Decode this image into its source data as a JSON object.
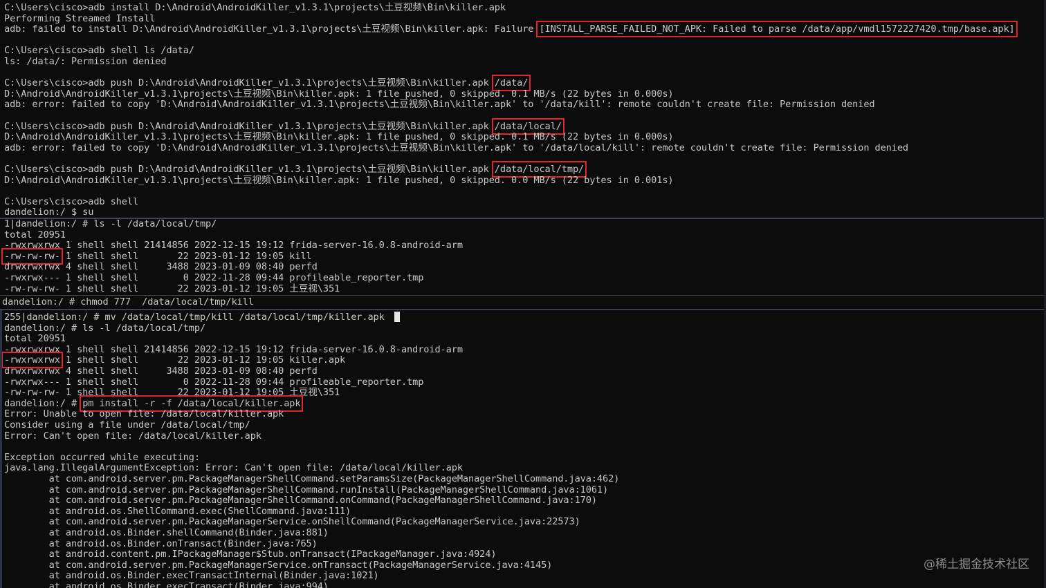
{
  "top": [
    "C:\\Users\\cisco>adb install D:\\Android\\AndroidKiller_v1.3.1\\projects\\土豆视频\\Bin\\killer.apk",
    "Performing Streamed Install",
    {
      "pre": "adb: failed to install D:\\Android\\AndroidKiller_v1.3.1\\projects\\土豆视频\\Bin\\killer.apk: Failure ",
      "hl": "[INSTALL_PARSE_FAILED_NOT_APK: Failed to parse /data/app/vmdl1572227420.tmp/base.apk]"
    },
    "",
    "C:\\Users\\cisco>adb shell ls /data/",
    "ls: /data/: Permission denied",
    "",
    {
      "pre": "C:\\Users\\cisco>adb push D:\\Android\\AndroidKiller_v1.3.1\\projects\\土豆视频\\Bin\\killer.apk ",
      "hl": "/data/"
    },
    "D:\\Android\\AndroidKiller_v1.3.1\\projects\\土豆视频\\Bin\\killer.apk: 1 file pushed, 0 skipped. 0.1 MB/s (22 bytes in 0.000s)",
    "adb: error: failed to copy 'D:\\Android\\AndroidKiller_v1.3.1\\projects\\土豆视频\\Bin\\killer.apk' to '/data/kill': remote couldn't create file: Permission denied",
    "",
    {
      "pre": "C:\\Users\\cisco>adb push D:\\Android\\AndroidKiller_v1.3.1\\projects\\土豆视频\\Bin\\killer.apk ",
      "hl": "/data/local/"
    },
    "D:\\Android\\AndroidKiller_v1.3.1\\projects\\土豆视频\\Bin\\killer.apk: 1 file pushed, 0 skipped. 0.1 MB/s (22 bytes in 0.000s)",
    "adb: error: failed to copy 'D:\\Android\\AndroidKiller_v1.3.1\\projects\\土豆视频\\Bin\\killer.apk' to '/data/local/kill': remote couldn't create file: Permission denied",
    "",
    {
      "pre": "C:\\Users\\cisco>adb push D:\\Android\\AndroidKiller_v1.3.1\\projects\\土豆视频\\Bin\\killer.apk ",
      "hl": "/data/local/tmp/"
    },
    "D:\\Android\\AndroidKiller_v1.3.1\\projects\\土豆视频\\Bin\\killer.apk: 1 file pushed, 0 skipped. 0.0 MB/s (22 bytes in 0.001s)",
    "",
    "C:\\Users\\cisco>adb shell",
    "dandelion:/ $ su"
  ],
  "mid": [
    "1|dandelion:/ # ls -l /data/local/tmp/",
    "total 20951",
    "-rwxrwxrwx 1 shell shell 21414856 2022-12-15 19:12 frida-server-16.0.8-android-arm",
    {
      "hl": "-rw-rw-rw-",
      "post": " 1 shell shell       22 2023-01-12 19:05 kill"
    },
    "drwxrwxrwx 4 shell shell     3488 2023-01-09 08:40 perfd",
    "-rwxrwx--- 1 shell shell        0 2022-11-28 09:44 profileable_reporter.tmp",
    "-rw-rw-rw- 1 shell shell       22 2023-01-12 19:05 土豆视\\351"
  ],
  "cmd": "dandelion:/ # chmod 777  /data/local/tmp/kill",
  "bottom": [
    {
      "pre": "255|dandelion:/ # mv /data/local/tmp/kill /data/local/tmp/killer.apk",
      "cursor": true
    },
    "dandelion:/ # ls -l /data/local/tmp/",
    "total 20951",
    "-rwxrwxrwx 1 shell shell 21414856 2022-12-15 19:12 frida-server-16.0.8-android-arm",
    {
      "hl": "-rwxrwxrwx",
      "post": " 1 shell shell       22 2023-01-12 19:05 killer.apk"
    },
    "drwxrwxrwx 4 shell shell     3488 2023-01-09 08:40 perfd",
    "-rwxrwx--- 1 shell shell        0 2022-11-28 09:44 profileable_reporter.tmp",
    "-rw-rw-rw- 1 shell shell       22 2023-01-12 19:05 土豆视\\351",
    {
      "pre": "dandelion:/ # ",
      "hl": "pm install -r -f /data/local/killer.apk"
    },
    "Error: Unable to open file: /data/local/killer.apk",
    "Consider using a file under /data/local/tmp/",
    "Error: Can't open file: /data/local/killer.apk",
    "",
    "Exception occurred while executing:",
    "java.lang.IllegalArgumentException: Error: Can't open file: /data/local/killer.apk",
    "        at com.android.server.pm.PackageManagerShellCommand.setParamsSize(PackageManagerShellCommand.java:462)",
    "        at com.android.server.pm.PackageManagerShellCommand.runInstall(PackageManagerShellCommand.java:1061)",
    "        at com.android.server.pm.PackageManagerShellCommand.onCommand(PackageManagerShellCommand.java:170)",
    "        at android.os.ShellCommand.exec(ShellCommand.java:111)",
    "        at com.android.server.pm.PackageManagerService.onShellCommand(PackageManagerService.java:22573)",
    "        at android.os.Binder.shellCommand(Binder.java:881)",
    "        at android.os.Binder.onTransact(Binder.java:765)",
    "        at android.content.pm.IPackageManager$Stub.onTransact(IPackageManager.java:4924)",
    "        at com.android.server.pm.PackageManagerService.onTransact(PackageManagerService.java:4145)",
    "        at android.os.Binder.execTransactInternal(Binder.java:1021)",
    "        at android.os.Binder.execTransact(Binder.java:994)"
  ],
  "watermark": "@稀土掘金技术社区",
  "colors": {
    "background": "#0c0c0c",
    "text": "#c8c8c8",
    "highlight": "#e0252c"
  }
}
